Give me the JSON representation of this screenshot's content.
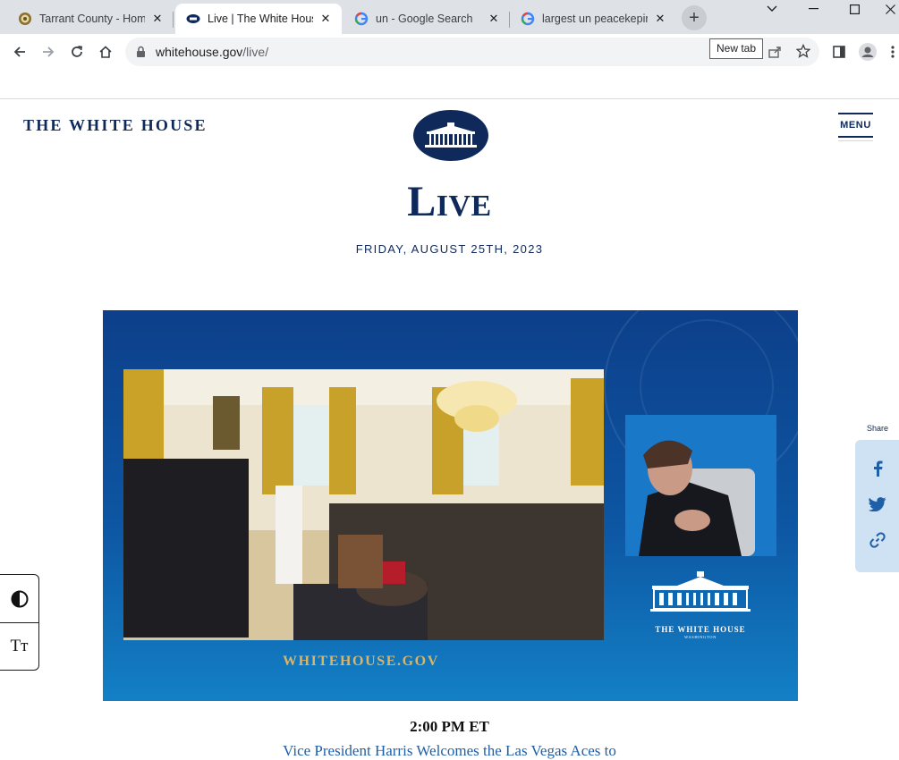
{
  "browser": {
    "tabs": [
      {
        "label": "Tarrant County - Home",
        "icon": "county-seal-icon",
        "active": false
      },
      {
        "label": "Live | The White House",
        "icon": "white-house-icon",
        "active": true
      },
      {
        "label": "un - Google Search",
        "icon": "google-icon",
        "active": false
      },
      {
        "label": "largest un peacekeping",
        "icon": "google-icon",
        "active": false
      }
    ],
    "new_tab_symbol": "+",
    "close_symbol": "✕",
    "url_host": "whitehouse.gov",
    "url_path": "/live/",
    "tooltip": "New tab"
  },
  "site": {
    "brand": "THE WHITE HOUSE",
    "menu_label": "MENU"
  },
  "page": {
    "title": "Live",
    "date": "FRIDAY, AUGUST 25TH, 2023"
  },
  "video": {
    "overlay_title": "THE WHITE HOUSE",
    "overlay_subtitle": "WASHINGTON",
    "overlay_url": "WHITEHOUSE.GOV"
  },
  "event": {
    "time": "2:00 PM ET",
    "title": "Vice President Harris Welcomes the Las Vegas Aces to"
  },
  "share": {
    "label": "Share",
    "items": [
      "facebook-icon",
      "twitter-icon",
      "link-icon"
    ]
  },
  "accessibility": {
    "text_size_label": "Tт"
  },
  "colors": {
    "navy": "#0f2a5a",
    "link": "#1f5fa8",
    "share_bg": "#cfe2f3",
    "gold": "#d9b56a"
  }
}
